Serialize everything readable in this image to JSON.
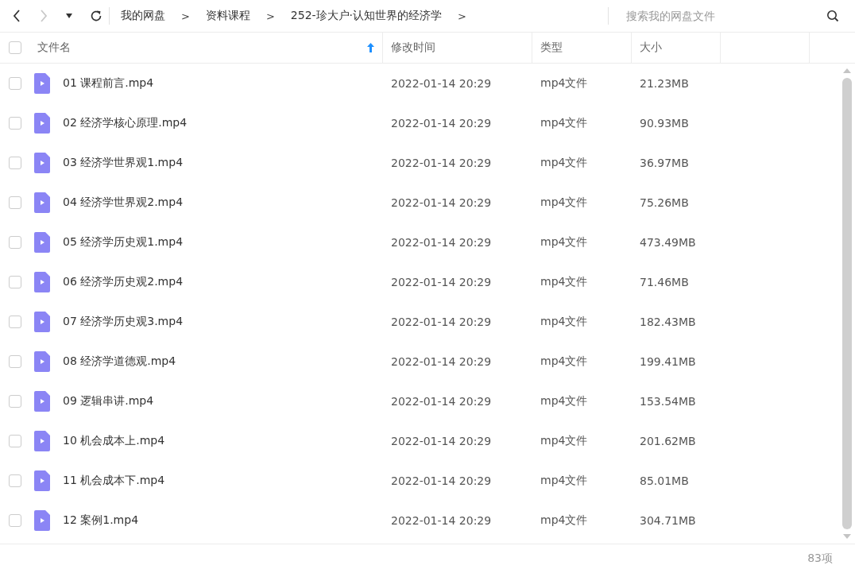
{
  "toolbar": {
    "back_disabled": false,
    "forward_disabled": true,
    "breadcrumbs": [
      {
        "kind": "crumb",
        "label": "我的网盘"
      },
      {
        "kind": "separator",
        "label": ">"
      },
      {
        "kind": "crumb",
        "label": "资料课程"
      },
      {
        "kind": "separator",
        "label": ">"
      },
      {
        "kind": "crumb",
        "label": "252-珍大户·认知世界的经济学"
      },
      {
        "kind": "separator",
        "label": ">"
      }
    ],
    "search": {
      "placeholder": "搜索我的网盘文件"
    }
  },
  "table": {
    "select_all_checked": false,
    "columns": [
      {
        "label": "文件名",
        "sorted": true
      },
      {
        "label": "修改时间",
        "sorted": false
      },
      {
        "label": "类型",
        "sorted": false
      },
      {
        "label": "大小",
        "sorted": false
      }
    ],
    "rows": [
      {
        "name": "01 课程前言.mp4",
        "modified": "2022-01-14 20:29",
        "type": "mp4文件",
        "size": "21.23MB",
        "checked": false
      },
      {
        "name": "02 经济学核心原理.mp4",
        "modified": "2022-01-14 20:29",
        "type": "mp4文件",
        "size": "90.93MB",
        "checked": false
      },
      {
        "name": "03 经济学世界观1.mp4",
        "modified": "2022-01-14 20:29",
        "type": "mp4文件",
        "size": "36.97MB",
        "checked": false
      },
      {
        "name": "04 经济学世界观2.mp4",
        "modified": "2022-01-14 20:29",
        "type": "mp4文件",
        "size": "75.26MB",
        "checked": false
      },
      {
        "name": "05 经济学历史观1.mp4",
        "modified": "2022-01-14 20:29",
        "type": "mp4文件",
        "size": "473.49MB",
        "checked": false
      },
      {
        "name": "06 经济学历史观2.mp4",
        "modified": "2022-01-14 20:29",
        "type": "mp4文件",
        "size": "71.46MB",
        "checked": false
      },
      {
        "name": "07 经济学历史观3.mp4",
        "modified": "2022-01-14 20:29",
        "type": "mp4文件",
        "size": "182.43MB",
        "checked": false
      },
      {
        "name": "08 经济学道德观.mp4",
        "modified": "2022-01-14 20:29",
        "type": "mp4文件",
        "size": "199.41MB",
        "checked": false
      },
      {
        "name": "09 逻辑串讲.mp4",
        "modified": "2022-01-14 20:29",
        "type": "mp4文件",
        "size": "153.54MB",
        "checked": false
      },
      {
        "name": "10 机会成本上.mp4",
        "modified": "2022-01-14 20:29",
        "type": "mp4文件",
        "size": "201.62MB",
        "checked": false
      },
      {
        "name": "11 机会成本下.mp4",
        "modified": "2022-01-14 20:29",
        "type": "mp4文件",
        "size": "85.01MB",
        "checked": false
      },
      {
        "name": "12 案例1.mp4",
        "modified": "2022-01-14 20:29",
        "type": "mp4文件",
        "size": "304.71MB",
        "checked": false
      }
    ]
  },
  "status_bar": {
    "count": "83项"
  }
}
